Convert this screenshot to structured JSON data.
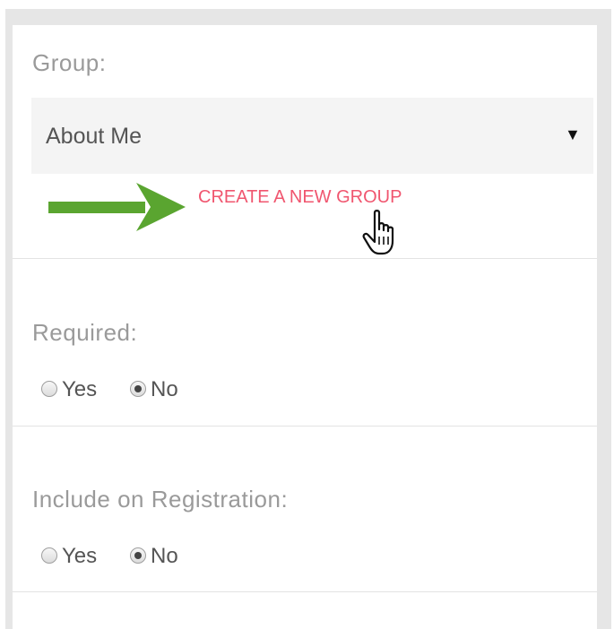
{
  "group_section": {
    "label": "Group:",
    "select": {
      "selected_value": "About Me",
      "caret_icon": "caret-down-icon"
    },
    "create_link_label": "CREATE A NEW GROUP",
    "arrow_icon": "green-arrow-icon",
    "cursor_icon": "hand-pointer-icon"
  },
  "required_section": {
    "label": "Required:",
    "options": [
      {
        "label": "Yes",
        "checked": false
      },
      {
        "label": "No",
        "checked": true
      }
    ]
  },
  "registration_section": {
    "label": "Include on Registration:",
    "options": [
      {
        "label": "Yes",
        "checked": false
      },
      {
        "label": "No",
        "checked": true
      }
    ]
  },
  "colors": {
    "link": "#f0566f",
    "arrow": "#5aa530",
    "label": "#9a9a9a",
    "select_background": "#f4f4f4",
    "frame": "#e6e6e6"
  }
}
